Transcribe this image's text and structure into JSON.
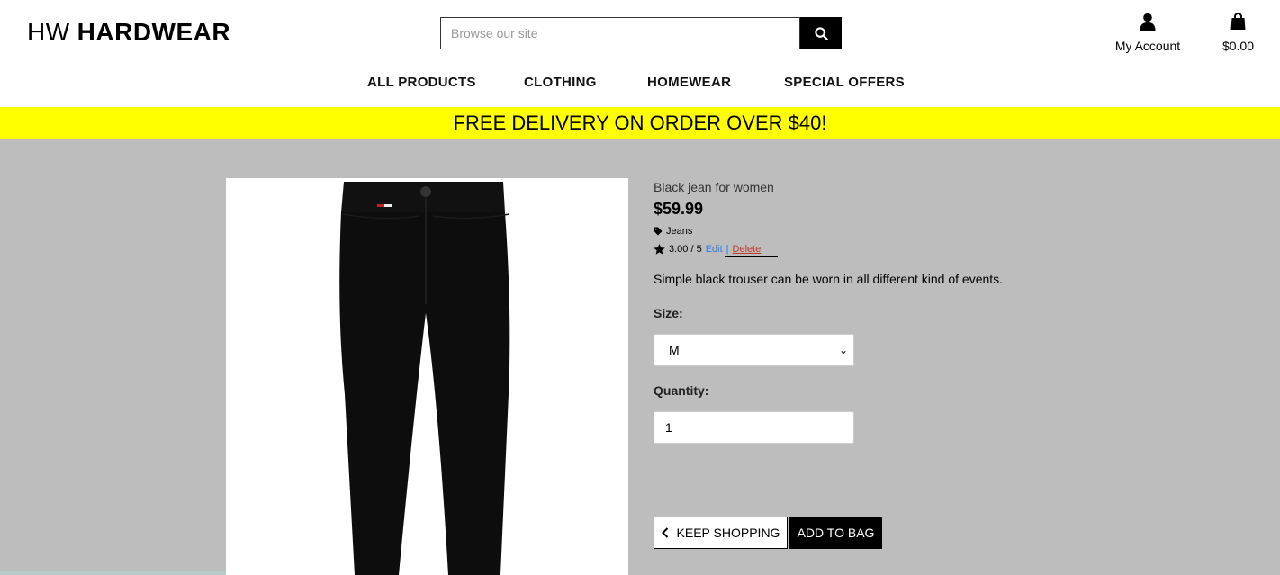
{
  "brand": {
    "prefix": "HW",
    "name": "HARDWEAR"
  },
  "search": {
    "placeholder": "Browse our site",
    "icon": "search-icon"
  },
  "account": {
    "label": "My Account",
    "icon": "user-icon"
  },
  "bag": {
    "total": "$0.00",
    "icon": "shopping-bag-icon"
  },
  "nav": {
    "items": [
      "ALL PRODUCTS",
      "CLOTHING",
      "HOMEWEAR",
      "SPECIAL OFFERS"
    ]
  },
  "banner": {
    "text": "FREE DELIVERY ON ORDER OVER $40!",
    "color": "#ffff00"
  },
  "product": {
    "name": "Black jean for women",
    "price": "$59.99",
    "category": "Jeans",
    "rating": "3.00 / 5",
    "edit_label": "Edit",
    "separator": "|",
    "delete_label": "Delete",
    "description": "Simple black trouser can be worn in all different kind of events.",
    "size_label": "Size:",
    "size_value": "M",
    "quantity_label": "Quantity:",
    "quantity_value": "1"
  },
  "buttons": {
    "keep_shopping": "KEEP SHOPPING",
    "add_to_bag": "ADD TO BAG"
  },
  "colors": {
    "background": "#bdbdbd",
    "banner": "#ffff00",
    "edit_link": "#2a7ae2",
    "delete_link": "#c0392b"
  }
}
